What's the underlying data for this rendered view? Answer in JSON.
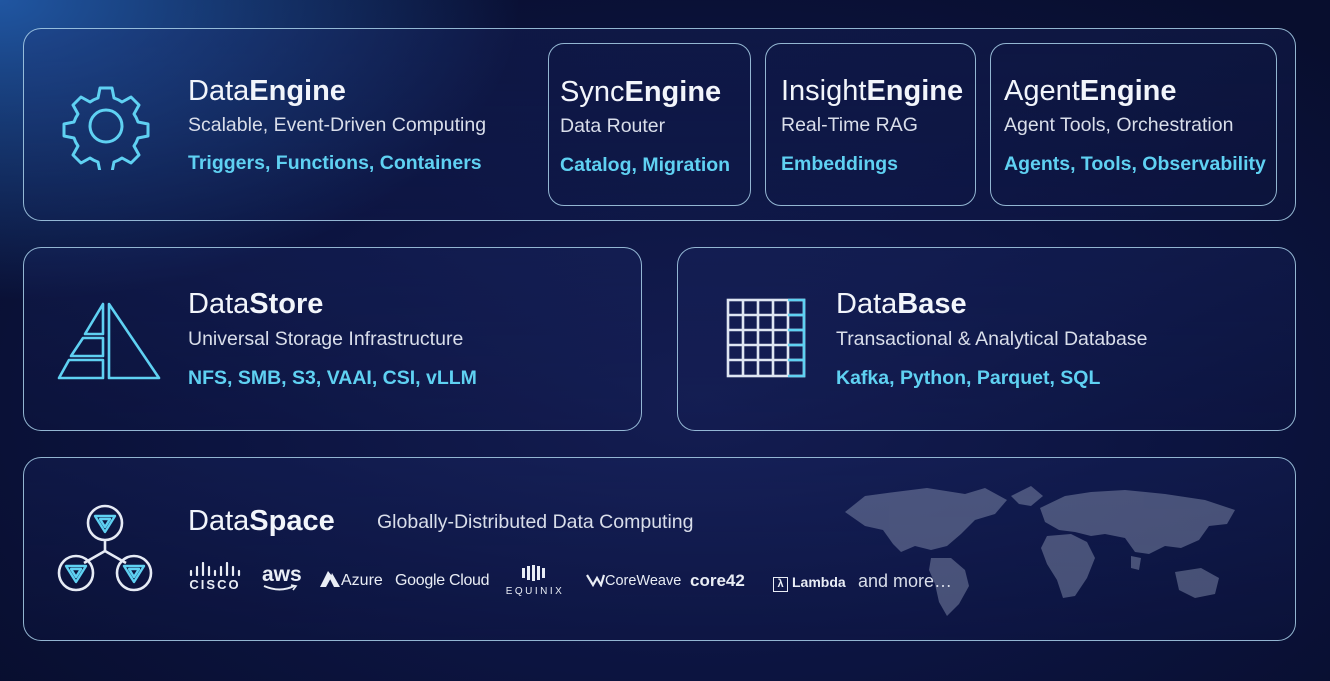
{
  "dataengine": {
    "title_prefix": "Data",
    "title_bold": "Engine",
    "subtitle": "Scalable, Event-Driven Computing",
    "tags": "Triggers, Functions, Containers",
    "icon": "gear-icon"
  },
  "syncengine": {
    "title_prefix": "Sync",
    "title_bold": "Engine",
    "subtitle": "Data Router",
    "tags": "Catalog, Migration"
  },
  "insightengine": {
    "title_prefix": "Insight",
    "title_bold": "Engine",
    "subtitle": "Real-Time RAG",
    "tags": "Embeddings"
  },
  "agentengine": {
    "title_prefix": "Agent",
    "title_bold": "Engine",
    "subtitle": "Agent Tools, Orchestration",
    "tags": "Agents, Tools, Observability"
  },
  "datastore": {
    "title_prefix": "Data",
    "title_bold": "Store",
    "subtitle": "Universal Storage Infrastructure",
    "tags": "NFS, SMB, S3, VAAI, CSI, vLLM",
    "icon": "pyramid-icon"
  },
  "database": {
    "title_prefix": "Data",
    "title_bold": "Base",
    "subtitle": "Transactional & Analytical Database",
    "tags": "Kafka, Python, Parquet, SQL",
    "icon": "grid-table-icon"
  },
  "dataspace": {
    "title_prefix": "Data",
    "title_bold": "Space",
    "subtitle": "Globally-Distributed Data Computing",
    "icon": "network-nodes-icon",
    "partners": {
      "cisco": "CISCO",
      "aws": "aws",
      "azure": "Azure",
      "google": "Google Cloud",
      "equinix": "EQUINIX",
      "coreweave": "CoreWeave",
      "core42": "core42",
      "lambda": "Lambda",
      "more": "and more…"
    }
  },
  "colors": {
    "accent": "#5fd1f2",
    "border": "#aad2eb",
    "background": "#0c1440"
  }
}
